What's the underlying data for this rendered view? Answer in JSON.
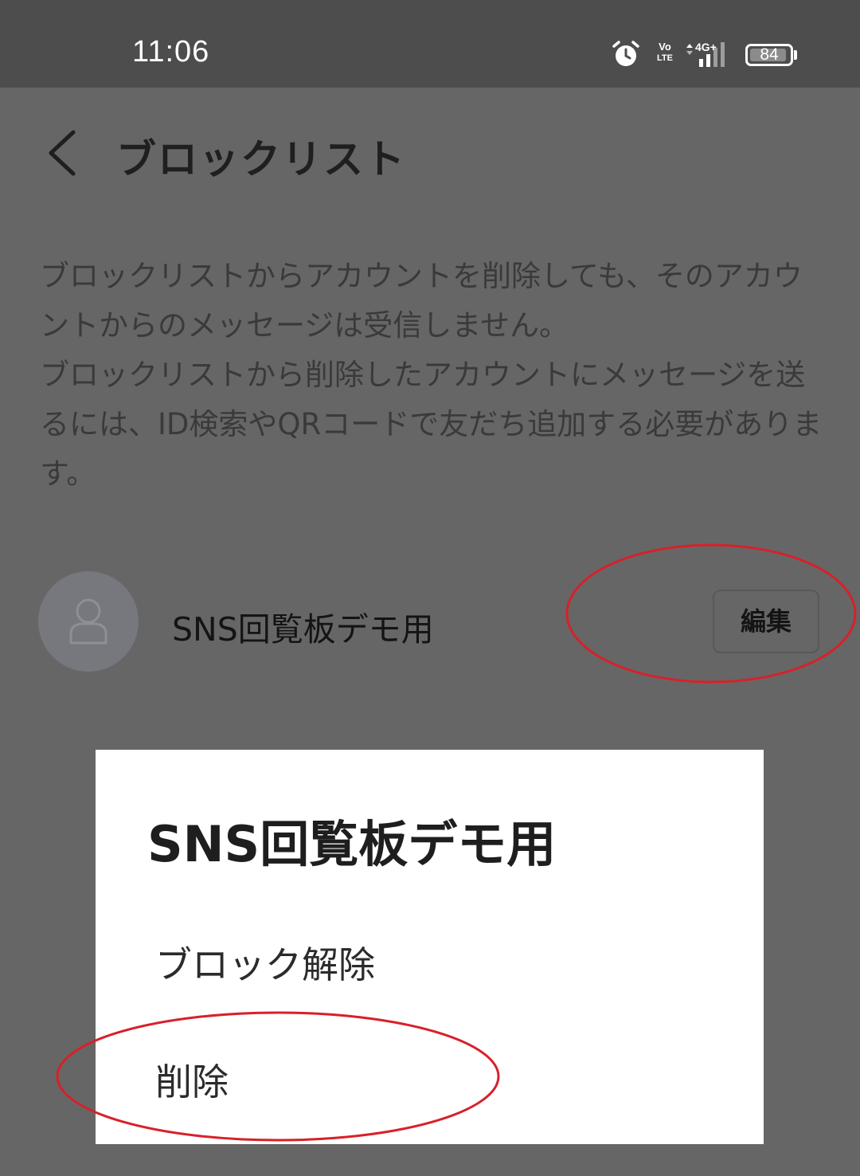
{
  "status_bar": {
    "time": "11:06",
    "volte_top": "Vo",
    "volte_bottom": "LTE",
    "network": "4G+",
    "battery": "84",
    "icons": [
      "alarm-icon",
      "volte-icon",
      "signal-icon",
      "battery-icon"
    ]
  },
  "header": {
    "back_icon": "chevron-left-icon",
    "title": "ブロックリスト"
  },
  "description": "ブロックリストからアカウントを削除しても、そのアカウントからのメッセージは受信しません。\nブロックリストから削除したアカウントにメッセージを送るには、ID検索やQRコードで友だち追加する必要があります。",
  "blocked_account": {
    "avatar_icon": "person-icon",
    "name": "SNS回覧板デモ用",
    "edit_label": "編集"
  },
  "dialog": {
    "title": "SNS回覧板デモ用",
    "options": [
      "ブロック解除",
      "削除"
    ]
  },
  "colors": {
    "overlay_background": "#666666",
    "status_bar": "#4d4d4d",
    "dialog_background": "#ffffff",
    "annotation_red": "#d8202a"
  }
}
